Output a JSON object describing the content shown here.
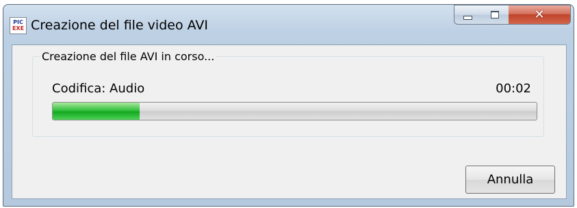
{
  "window": {
    "title": "Creazione del file video AVI",
    "app_icon": {
      "name": "pic-exe-icon",
      "line1": "PIC",
      "line2": "EXE"
    }
  },
  "controls": {
    "minimize": "minimize-icon",
    "maximize": "maximize-icon",
    "close": "close-icon"
  },
  "group": {
    "label": "Creazione del file AVI in corso..."
  },
  "progress": {
    "status": "Codifica: Audio",
    "elapsed": "00:02",
    "fraction": 0.18,
    "fill_color": "#22b02e"
  },
  "buttons": {
    "cancel": "Annulla"
  }
}
